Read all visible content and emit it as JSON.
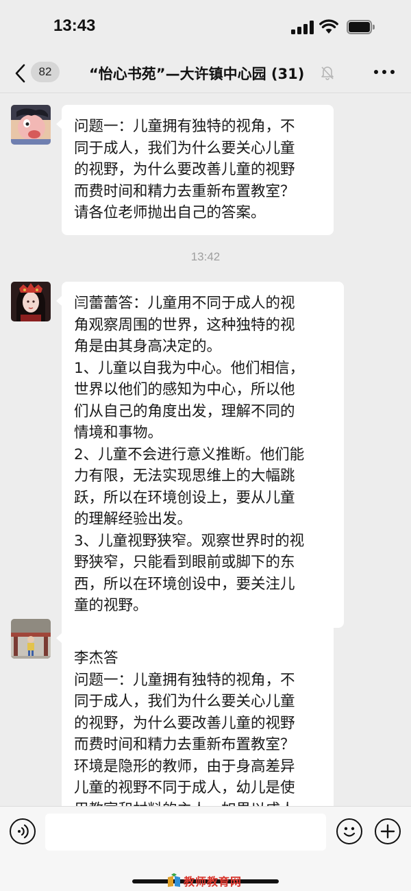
{
  "status_bar": {
    "time": "13:43"
  },
  "nav": {
    "unread_count": "82",
    "title": "“怡心书苑”—大许镇中心园 (31)"
  },
  "messages": [
    {
      "lines": [
        "问题一：儿童拥有独特的视角，不",
        "同于成人，我们为什么要关心儿童",
        "的视野，为什么要改善儿童的视野",
        "而费时间和精力去重新布置教室？",
        "请各位老师抛出自己的答案。"
      ]
    },
    {
      "lines": [
        "闫蕾蕾答：儿童用不同于成人的视",
        "角观察周围的世界，这种独特的视",
        "角是由其身高决定的。",
        "1、儿童以自我为中心。他们相信，",
        "世界以他们的感知为中心，所以他",
        "们从自己的角度出发，理解不同的",
        "情境和事物。",
        "2、儿童不会进行意义推断。他们能",
        "力有限，无法实现思维上的大幅跳",
        "跃，所以在环境创设上，要从儿童",
        "的理解经验出发。",
        "3、儿童视野狭窄。观察世界时的视",
        "野狭窄，只能看到眼前或脚下的东",
        "西，所以在环境创设中，要关注儿",
        "童的视野。"
      ]
    },
    {
      "lines": [
        "李杰答",
        "问题一：儿童拥有独特的视角，不",
        "同于成人，我们为什么要关心儿童",
        "的视野，为什么要改善儿童的视野",
        "而费时间和精力去重新布置教室？",
        "环境是隐形的教师，由于身高差异",
        "儿童的视野不同于成人，幼儿是使",
        "用教室和材料的主人，如果以成人"
      ]
    }
  ],
  "timestamp": "13:42",
  "input": {
    "value": ""
  },
  "watermark": {
    "text": "教师教育网"
  }
}
